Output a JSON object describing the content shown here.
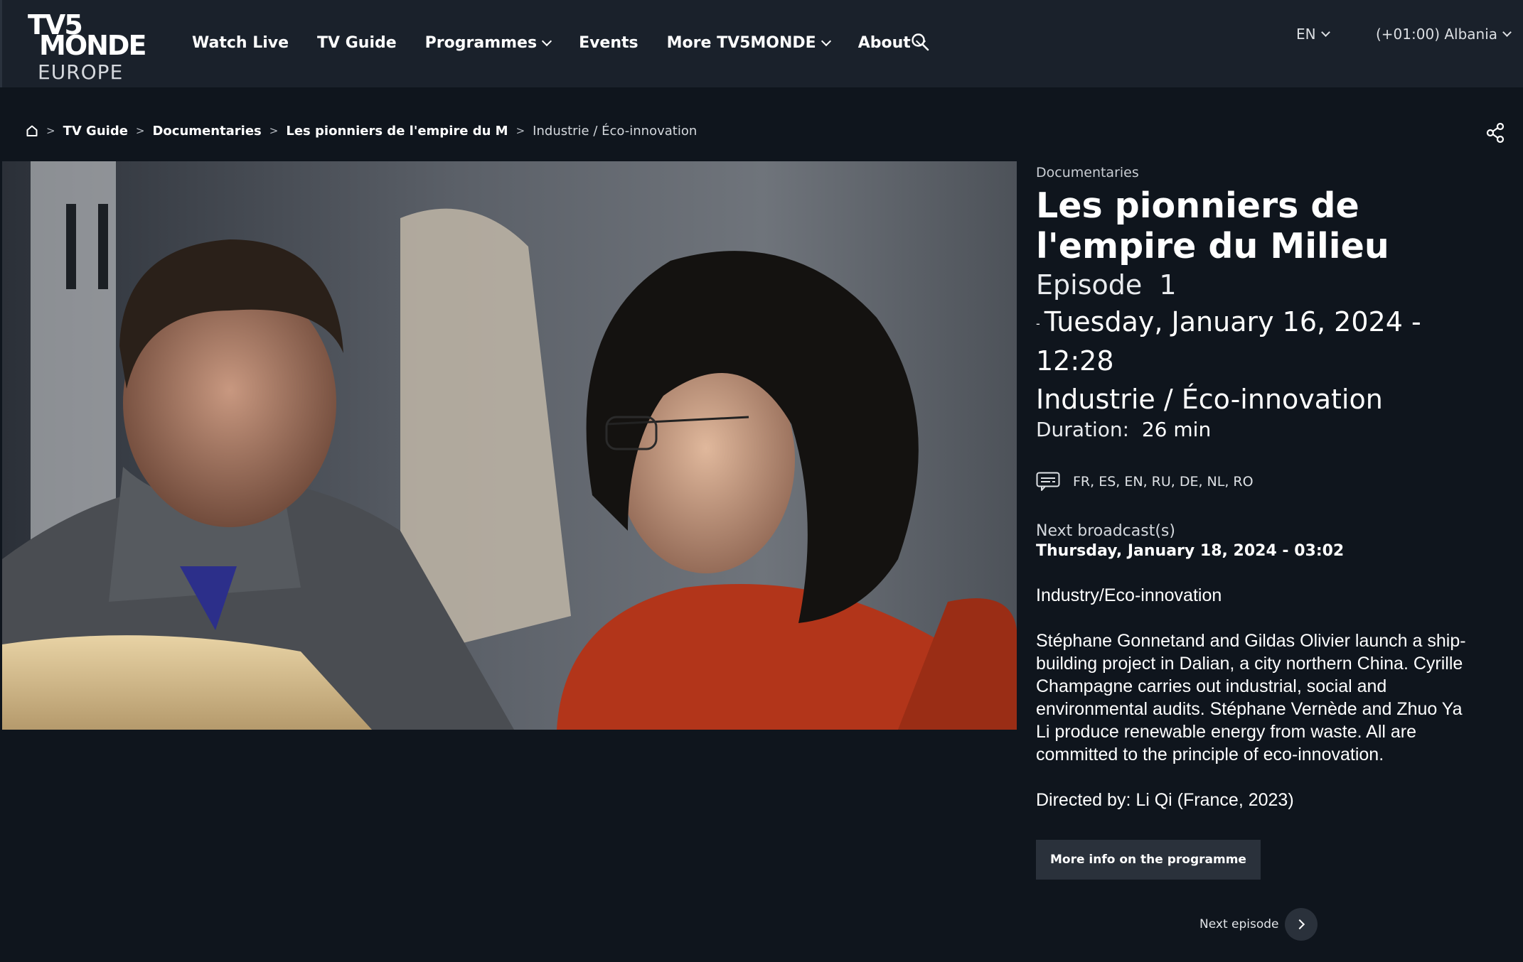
{
  "logo": {
    "line1": "TV5",
    "line2": "MONDE",
    "line3": "EUROPE"
  },
  "nav": {
    "items": [
      {
        "label": "Watch Live",
        "dropdown": false
      },
      {
        "label": "TV Guide",
        "dropdown": false
      },
      {
        "label": "Programmes",
        "dropdown": true
      },
      {
        "label": "Events",
        "dropdown": false
      },
      {
        "label": "More TV5MONDE",
        "dropdown": true
      },
      {
        "label": "About",
        "dropdown": true
      }
    ],
    "search_icon": "search-icon"
  },
  "language": "EN",
  "timezone": "(+01:00) Albania",
  "breadcrumb": {
    "home_icon": "home-icon",
    "links": [
      "TV Guide",
      "Documentaries",
      "Les pionniers de l'empire du M"
    ],
    "current": "Industrie / Éco-innovation",
    "separator": ">"
  },
  "programme": {
    "category": "Documentaries",
    "title": "Les pionniers de l'empire du Milieu",
    "episode_label": "Episode",
    "episode_number": "1",
    "date_prefix": "-",
    "datetime": "Tuesday, January 16, 2024 - 12:28",
    "episode_title": "Industrie / Éco-innovation",
    "duration_label": "Duration:",
    "duration_value": "26 min",
    "subtitles": "FR, ES, EN, RU, DE, NL, RO",
    "next_broadcast_label": "Next broadcast(s)",
    "next_broadcast_date": "Thursday, January 18, 2024 - 03:02",
    "theme": "Industry/Eco-innovation",
    "description": "Stéphane Gonnetand and Gildas Olivier launch a ship-building project in Dalian, a city northern China. Cyrille Champagne carries out industrial, social and environmental audits. Stéphane Vernède and Zhuo Ya Li produce renewable energy from waste. All are committed to the principle of eco-innovation.",
    "directed_by": "Directed by: Li Qi (France, 2023)",
    "more_info_label": "More info on the programme",
    "next_episode_label": "Next episode"
  },
  "colors": {
    "background": "#0f151d",
    "header": "#1a212b",
    "button": "#2a313b"
  }
}
